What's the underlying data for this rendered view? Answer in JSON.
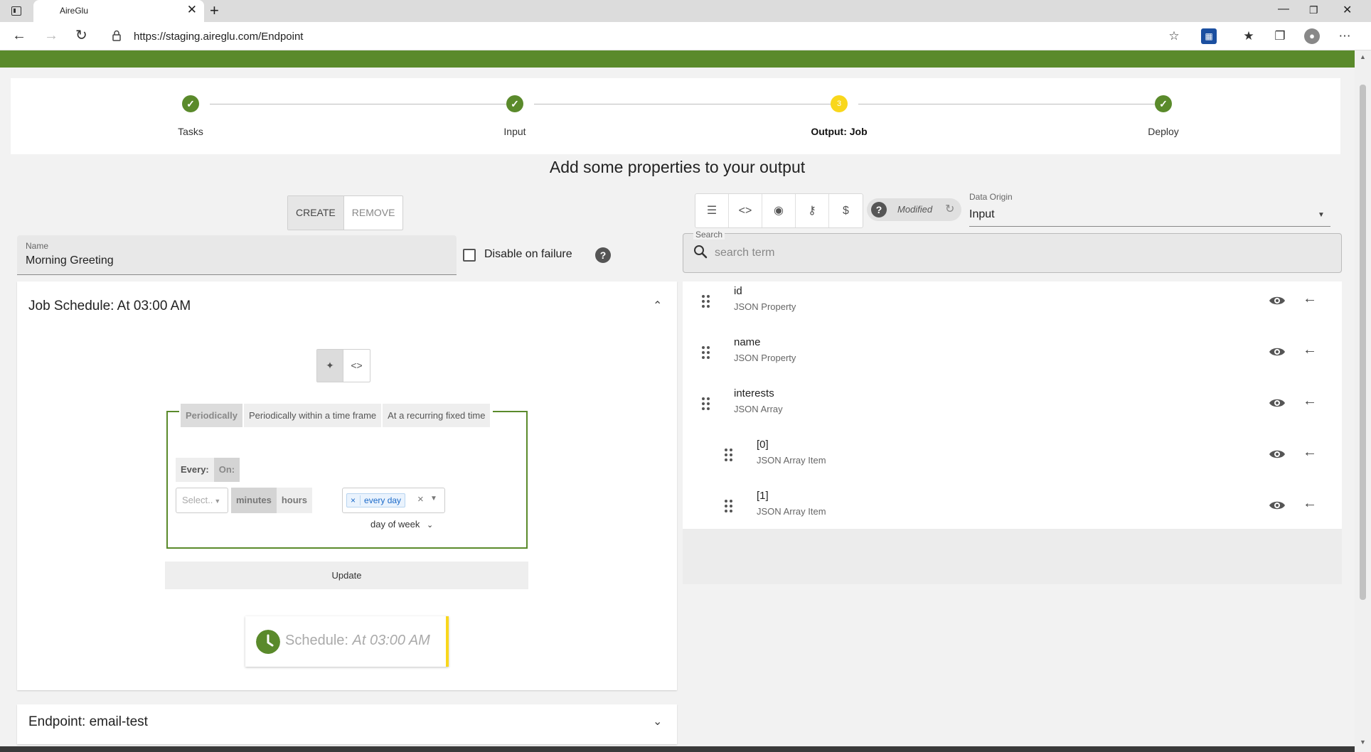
{
  "browser": {
    "tab_title": "AireGlu",
    "tab_close": "✕",
    "new_tab": "+",
    "url": "https://staging.aireglu.com/Endpoint"
  },
  "stepper": {
    "steps": [
      {
        "label": "Tasks",
        "state": "done"
      },
      {
        "label": "Input",
        "state": "done"
      },
      {
        "label": "Output: Job",
        "state": "active",
        "number": "3"
      },
      {
        "label": "Deploy",
        "state": "done"
      }
    ]
  },
  "page_title": "Add some properties to your output",
  "left": {
    "create_label": "CREATE",
    "remove_label": "REMOVE",
    "name_label": "Name",
    "name_value": "Morning Greeting",
    "disable_label": "Disable on failure",
    "help_glyph": "?",
    "schedule_panel": {
      "title": "Job Schedule: At 03:00 AM",
      "cron_tabs": [
        "Periodically",
        "Periodically within a time frame",
        "At a recurring fixed time"
      ],
      "every_label": "Every:",
      "on_label": "On:",
      "select_placeholder": "Select..",
      "minutes_label": "minutes",
      "hours_label": "hours",
      "chip_remove": "×",
      "chip_label": "every day",
      "clear_glyph": "×",
      "day_of_week_label": "day of week",
      "update_label": "Update",
      "schedule_prefix": "Schedule: ",
      "schedule_value": "At 03:00 AM"
    },
    "endpoint_panel": {
      "title": "Endpoint: email-test"
    }
  },
  "right": {
    "modified_label": "Modified",
    "data_origin_label": "Data Origin",
    "data_origin_value": "Input",
    "search_label": "Search",
    "search_placeholder": "search term",
    "properties": [
      {
        "name": "id",
        "type": "JSON Property",
        "indent": 0
      },
      {
        "name": "name",
        "type": "JSON Property",
        "indent": 0
      },
      {
        "name": "interests",
        "type": "JSON Array",
        "indent": 0
      },
      {
        "name": "[0]",
        "type": "JSON Array Item",
        "indent": 1
      },
      {
        "name": "[1]",
        "type": "JSON Array Item",
        "indent": 1
      }
    ]
  },
  "colors": {
    "brand_green": "#5a8a2b",
    "active_step": "#f9d71c"
  }
}
